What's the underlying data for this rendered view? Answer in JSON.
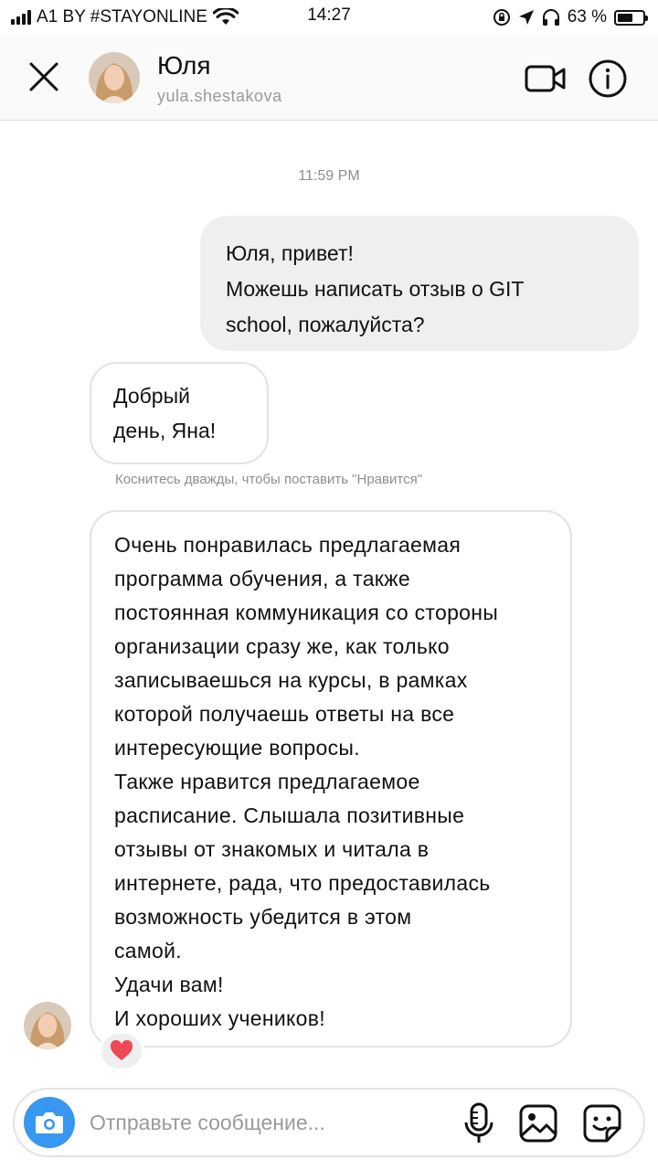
{
  "status_bar": {
    "carrier": "A1 BY #STAYONLINE",
    "time": "14:27",
    "battery": "63 %",
    "battery_level": 0.63,
    "icons": [
      "signal-icon",
      "wifi-icon",
      "orientation-lock-icon",
      "location-icon",
      "headphones-icon",
      "battery-icon"
    ]
  },
  "header": {
    "name": "Юля",
    "username": "yula.shestakova",
    "icons": [
      "close-icon",
      "video-call-icon",
      "info-icon"
    ]
  },
  "chat": {
    "timestamp": "11:59 PM",
    "messages": [
      {
        "direction": "outgoing",
        "lines": [
          "Юля, привет!",
          "Можешь написать отзыв о GIT",
          "school, пожалуйста?"
        ]
      },
      {
        "direction": "incoming",
        "lines": [
          "Добрый",
          "день, Яна!"
        ]
      },
      {
        "direction": "incoming",
        "lines": [
          "Очень понравилась предлагаемая",
          "программа обучения, а также",
          "постоянная коммуникация со стороны",
          "организации сразу же, как только",
          "записываешься на курсы, в рамках",
          "которой получаешь ответы на все",
          "интересующие вопросы.",
          "Также нравится предлагаемое",
          "расписание. Слышала позитивные",
          "отзывы от знакомых и читала в",
          "интернете, рада, что предоставилась",
          "возможность убедится в этом",
          "самой.",
          "Удачи вам!",
          "И хороших учеников!"
        ],
        "reaction": "heart-icon"
      }
    ],
    "double_tap_hint": "Коснитесь дважды, чтобы поставить \"Нравится\""
  },
  "composer": {
    "placeholder": "Отправьте сообщение...",
    "value": "",
    "icons": [
      "camera-icon",
      "microphone-icon",
      "gallery-icon",
      "sticker-icon"
    ],
    "camera_color": "#3897f0"
  },
  "colors": {
    "outgoing_bubble": "#efefef",
    "incoming_border": "#e3e3e3",
    "secondary_text": "#8e8e8e",
    "heart": "#ed4956"
  }
}
